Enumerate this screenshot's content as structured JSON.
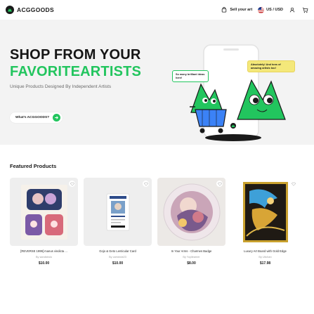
{
  "header": {
    "brand": "ACGGOODS",
    "sell_label": "Sell your art",
    "locale_label": "US / USD",
    "icons": [
      "logo-icon",
      "store-icon",
      "flag-icon",
      "user-icon",
      "cart-icon"
    ]
  },
  "hero": {
    "title_line1": "SHOP FROM YOUR",
    "title_line2": "FAVORITEARTISTS",
    "subtitle": "Unique Products Designed By Independent Artists",
    "cta_label": "What's ACGGOODS?",
    "bubble_left": "So many brilliant ideas here!",
    "bubble_right": "Absolutely! And tons of amazing artists too!",
    "accent_color": "#22c55e",
    "bubble_right_color": "#f4e87a"
  },
  "featured": {
    "title": "Featured Products",
    "products": [
      {
        "name": "[REVERSE 1999] manus vindicta ...",
        "by": "By sandstrulo",
        "price": "$10.00"
      },
      {
        "name": "Gojo & Geto Lenticular Card",
        "by": "By carrotdot23",
        "price": "$10.00"
      },
      {
        "name": "In Your Arms - Charmes Badge",
        "by": "By Yoyilearner",
        "price": "$8.00"
      },
      {
        "name": "Luxury Art Board with Gold Edge",
        "by": "By Uiichan",
        "price": "$17.98"
      }
    ]
  }
}
